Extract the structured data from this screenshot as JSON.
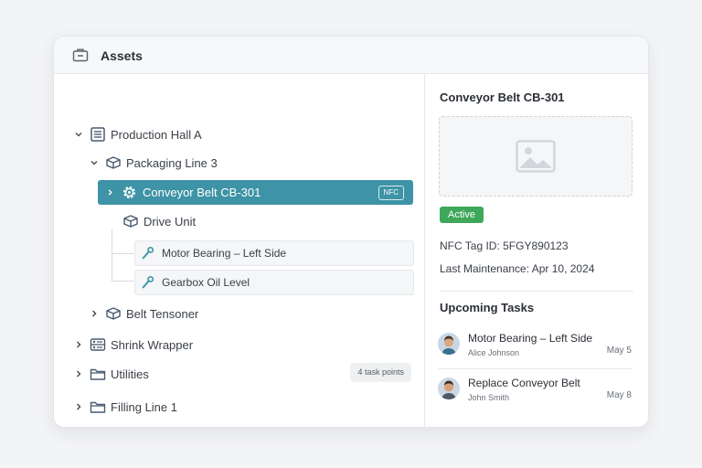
{
  "header": {
    "title": "Assets",
    "icon": "briefcase-icon"
  },
  "tree": {
    "production_hall": "Production Hall A",
    "packaging_line": "Packaging Line 3",
    "conveyor_belt": "Conveyor Belt CB-301",
    "nfc_badge": "NFC",
    "drive_unit": "Drive Unit",
    "motor_bearing": "Motor Bearing – Left Side",
    "gearbox_oil": "Gearbox Oil Level",
    "belt_tensoner": "Belt Tensoner",
    "shrink_wrapper": "Shrink Wrapper",
    "utilities": "Utilities",
    "utilities_badge": "4 task points",
    "filling_line": "Filling Line 1"
  },
  "detail": {
    "title": "Conveyor Belt CB-301",
    "status": "Active",
    "nfc_tag": "NFC Tag ID: 5FGY890123",
    "last_maintenance": "Last Maintenance: Apr 10, 2024",
    "tasks_title": "Upcoming Tasks",
    "tasks": [
      {
        "name": "Motor Bearing – Left Side",
        "person": "Alice Johnson",
        "date": "May 5"
      },
      {
        "name": "Replace Conveyor Belt",
        "person": "John Smith",
        "date": "May 8"
      }
    ]
  },
  "colors": {
    "selected": "#3e93a6",
    "active_status": "#3fa75a",
    "sensor_icon": "#3e93a6"
  }
}
